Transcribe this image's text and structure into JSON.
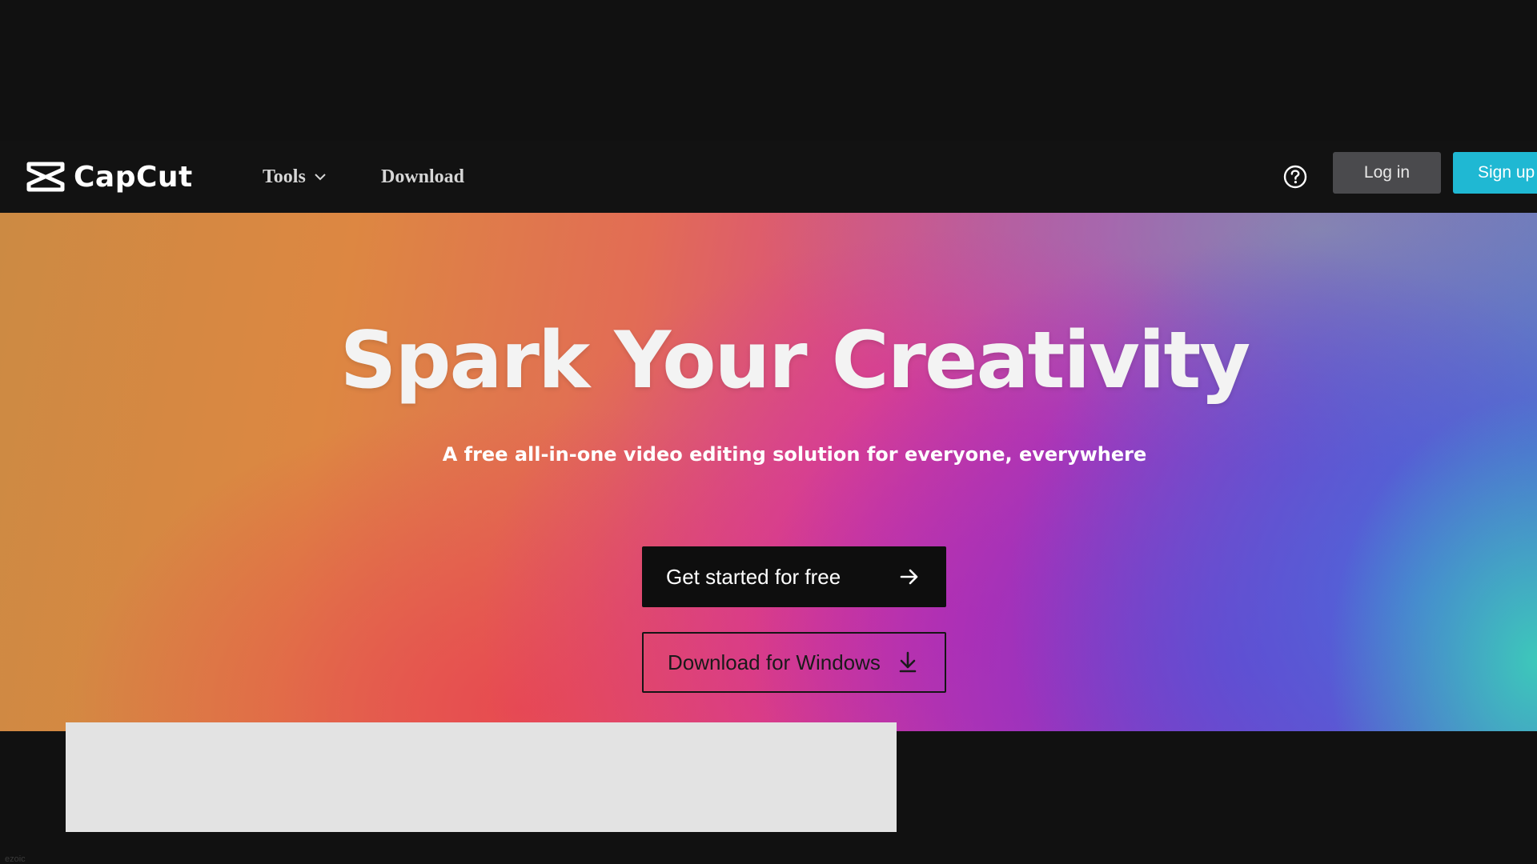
{
  "brand": {
    "name": "CapCut",
    "logo_icon": "capcut-logo-icon"
  },
  "nav": {
    "tools_label": "Tools",
    "download_label": "Download",
    "help_icon": "question-circle-icon",
    "login_label": "Log in",
    "signup_label": "Sign up"
  },
  "hero": {
    "title": "Spark Your Creativity",
    "subtitle": "A free all-in-one video editing solution for everyone, everywhere",
    "primary_cta": "Get started for free",
    "primary_cta_icon": "arrow-right-icon",
    "secondary_cta": "Download for Windows",
    "secondary_cta_icon": "download-icon"
  },
  "footer": {
    "watermark": "ezoic"
  },
  "colors": {
    "page_background": "#111111",
    "signup_accent": "#1fb8d3",
    "login_button": "#4a4a4d",
    "primary_cta_bg": "#0e0e0e",
    "ad_placeholder": "#e3e3e3"
  }
}
